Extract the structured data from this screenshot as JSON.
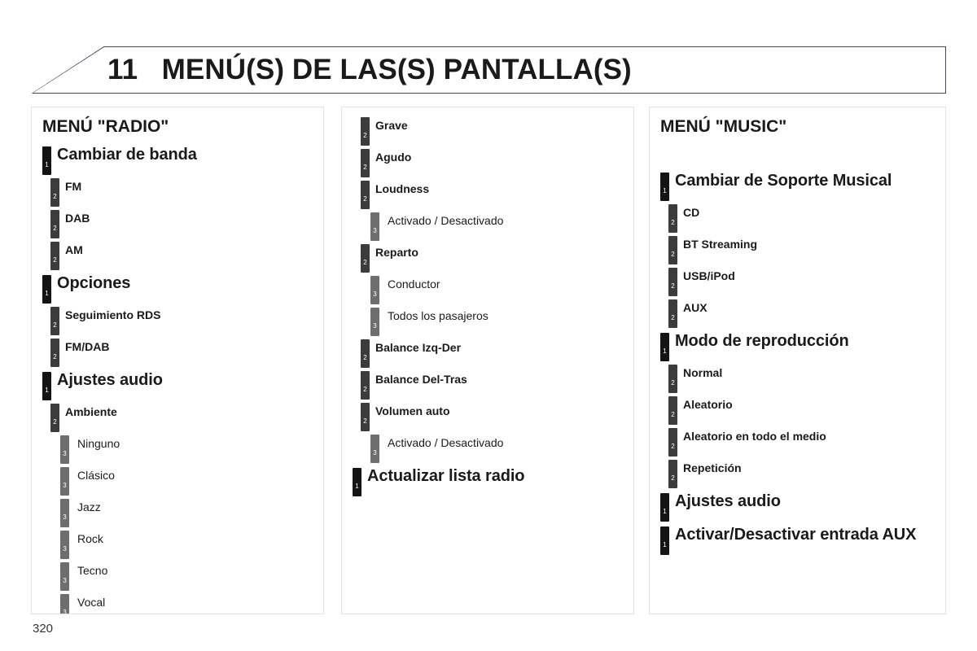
{
  "header": {
    "chapter_number": "11",
    "title": "MENÚ(S) DE LAS(S) PANTALLA(S)",
    "full_title": "11   MENÚ(S) DE LAS(S) PANTALLA(S)",
    "border_color": "#3b4a63"
  },
  "page_number": "320",
  "level_colors": {
    "level1": "#141414",
    "level2": "#3c3c3c",
    "level3": "#6e6e6e"
  },
  "columns": [
    {
      "heading": "MENÚ \"RADIO\"",
      "items": [
        {
          "level": 1,
          "label": "Cambiar de banda"
        },
        {
          "level": 2,
          "label": "FM"
        },
        {
          "level": 2,
          "label": "DAB"
        },
        {
          "level": 2,
          "label": "AM"
        },
        {
          "level": 1,
          "label": "Opciones"
        },
        {
          "level": 2,
          "label": "Seguimiento RDS"
        },
        {
          "level": 2,
          "label": "FM/DAB"
        },
        {
          "level": 1,
          "label": "Ajustes audio"
        },
        {
          "level": 2,
          "label": "Ambiente"
        },
        {
          "level": 3,
          "label": "Ninguno"
        },
        {
          "level": 3,
          "label": "Clásico"
        },
        {
          "level": 3,
          "label": "Jazz"
        },
        {
          "level": 3,
          "label": "Rock"
        },
        {
          "level": 3,
          "label": "Tecno"
        },
        {
          "level": 3,
          "label": "Vocal"
        }
      ]
    },
    {
      "heading": "",
      "items": [
        {
          "level": 2,
          "label": "Grave"
        },
        {
          "level": 2,
          "label": "Agudo"
        },
        {
          "level": 2,
          "label": "Loudness"
        },
        {
          "level": 3,
          "label": "Activado / Desactivado"
        },
        {
          "level": 2,
          "label": "Reparto"
        },
        {
          "level": 3,
          "label": "Conductor"
        },
        {
          "level": 3,
          "label": "Todos los pasajeros"
        },
        {
          "level": 2,
          "label": "Balance Izq-Der"
        },
        {
          "level": 2,
          "label": "Balance Del-Tras"
        },
        {
          "level": 2,
          "label": "Volumen auto"
        },
        {
          "level": 3,
          "label": "Activado / Desactivado"
        },
        {
          "level": 1,
          "label": "Actualizar lista radio"
        }
      ]
    },
    {
      "heading": "MENÚ \"MUSIC\"",
      "items": [
        {
          "level": 1,
          "label": "Cambiar de Soporte Musical"
        },
        {
          "level": 2,
          "label": "CD"
        },
        {
          "level": 2,
          "label": "BT Streaming"
        },
        {
          "level": 2,
          "label": "USB/iPod"
        },
        {
          "level": 2,
          "label": "AUX"
        },
        {
          "level": 1,
          "label": "Modo de reproducción"
        },
        {
          "level": 2,
          "label": "Normal"
        },
        {
          "level": 2,
          "label": "Aleatorio"
        },
        {
          "level": 2,
          "label": "Aleatorio en todo el medio"
        },
        {
          "level": 2,
          "label": "Repetición"
        },
        {
          "level": 1,
          "label": "Ajustes audio"
        },
        {
          "level": 1,
          "label": "Activar/Desactivar entrada AUX"
        }
      ]
    }
  ]
}
